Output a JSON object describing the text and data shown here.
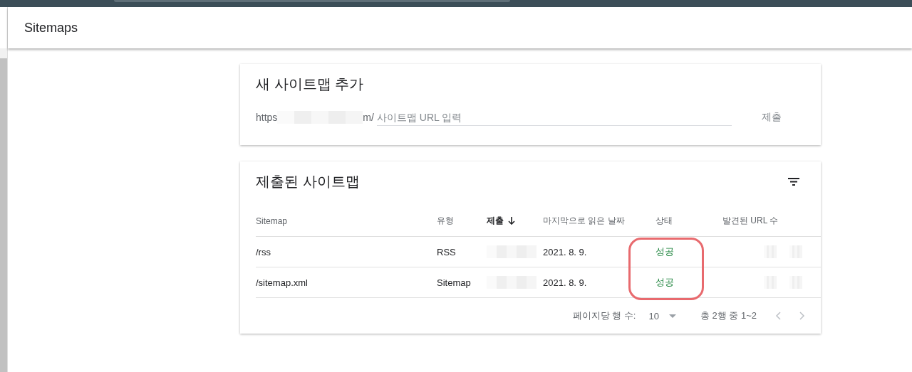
{
  "header": {
    "title": "Sitemaps"
  },
  "add_card": {
    "title": "새 사이트맵 추가",
    "url_prefix_start": "https",
    "url_prefix_end": "m/",
    "field": {
      "placeholder": "사이트맵 URL 입력"
    },
    "submit": "제출"
  },
  "submitted_card": {
    "title": "제출된 사이트맵",
    "columns": [
      {
        "label": "Sitemap",
        "sorted": false
      },
      {
        "label": "유형",
        "sorted": false
      },
      {
        "label": "제출",
        "sorted": true
      },
      {
        "label": "마지막으로 읽은 날짜",
        "sorted": false
      },
      {
        "label": "상태",
        "sorted": false
      },
      {
        "label": "발견된 URL 수",
        "sorted": false
      }
    ],
    "rows": [
      {
        "sitemap": "/rss",
        "type": "RSS",
        "last_read": "2021. 8. 9.",
        "status": "성공"
      },
      {
        "sitemap": "/sitemap.xml",
        "type": "Sitemap",
        "last_read": "2021. 8. 9.",
        "status": "성공"
      }
    ],
    "pagination": {
      "rows_per_page_label": "페이지당 행 수:",
      "rows_per_page": "10",
      "range": "총 2행 중 1~2"
    }
  }
}
